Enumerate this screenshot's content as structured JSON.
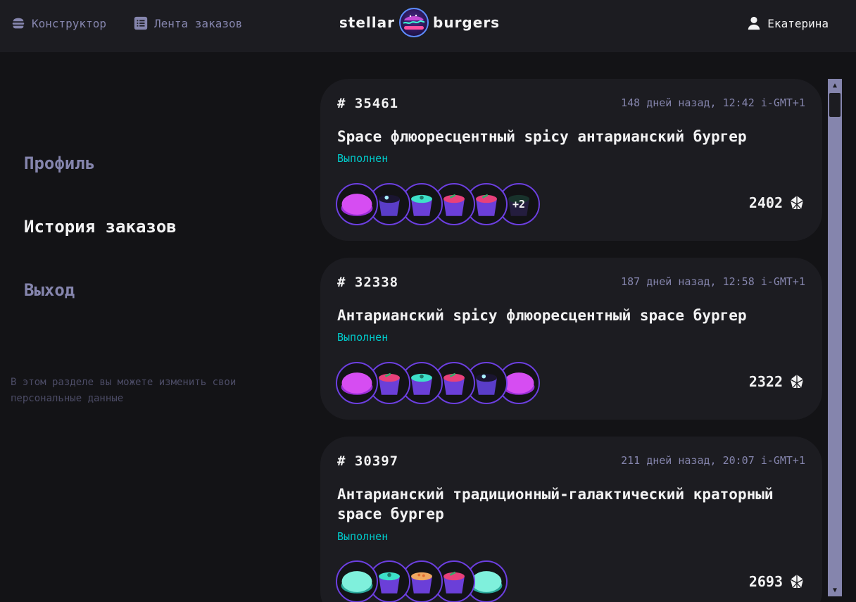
{
  "header": {
    "constructor_label": "Конструктор",
    "feed_label": "Лента заказов",
    "logo_left": "stellar",
    "logo_right": "burgers",
    "profile_label": "Екатерина"
  },
  "sidebar": {
    "profile": "Профиль",
    "history": "История заказов",
    "logout": "Выход",
    "hint": "В этом разделе вы можете изменить свои персональные данные"
  },
  "orders": [
    {
      "number": "# 35461",
      "date": "148 дней назад, 12:42 i-GMT+1",
      "title": "Space флюоресцентный spicy антарианский бургер",
      "status": "Выполнен",
      "price": "2402",
      "more": "+2",
      "ingredients": [
        "bun-purple",
        "sauce-dark",
        "sauce-green",
        "sauce-pink",
        "sauce-pink",
        "sauce-dark"
      ]
    },
    {
      "number": "# 32338",
      "date": "187 дней назад, 12:58 i-GMT+1",
      "title": "Антарианский spicy флюоресцентный space бургер",
      "status": "Выполнен",
      "price": "2322",
      "ingredients": [
        "bun-purple",
        "sauce-pink",
        "sauce-green",
        "sauce-pink",
        "sauce-dark",
        "bun-purple"
      ]
    },
    {
      "number": "# 30397",
      "date": "211 дней назад, 20:07 i-GMT+1",
      "title": "Антарианский традиционный-галактический краторный space бургер",
      "status": "Выполнен",
      "price": "2693",
      "ingredients": [
        "bun-teal",
        "sauce-green",
        "sauce-orange",
        "sauce-pink",
        "bun-teal"
      ]
    }
  ],
  "colors": {
    "background": "#131316",
    "card": "#1c1c21",
    "inactive_text": "#8585ad",
    "status": "#00cccc",
    "accent_border": "#6c3fe0"
  }
}
